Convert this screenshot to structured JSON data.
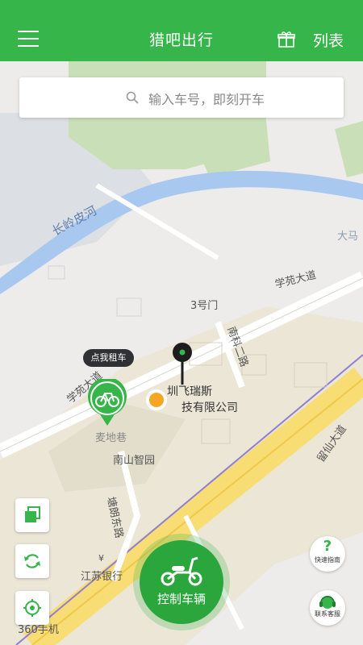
{
  "app": {
    "title": "猎吧出行"
  },
  "header": {
    "list_label": "列表"
  },
  "search": {
    "placeholder": "输入车号，即刻开车"
  },
  "map": {
    "labels": {
      "river": "长岭皮河",
      "dama": "大马",
      "gate": "3号门",
      "xueyuan_top": "学苑大道",
      "xueyuan_left": "学苑大道",
      "nanke": "南科二路",
      "company_line1": "圳飞瑞斯",
      "company_line2": "技有限公司",
      "maidi": "麦地巷",
      "park": "南山智园",
      "tanglang": "塘朗东路",
      "bank": "江苏银行",
      "yuxian": "留仙大道",
      "shop": "360手机"
    },
    "bubble_text": "点我租车"
  },
  "help": {
    "guide_label": "快速指南",
    "service_label": "联系客服"
  },
  "main_action": {
    "label": "控制车辆"
  },
  "colors": {
    "brand": "#36b54a",
    "brand_dark": "#2aa63c",
    "river": "#a9c8f0",
    "orange": "#f5a623"
  }
}
